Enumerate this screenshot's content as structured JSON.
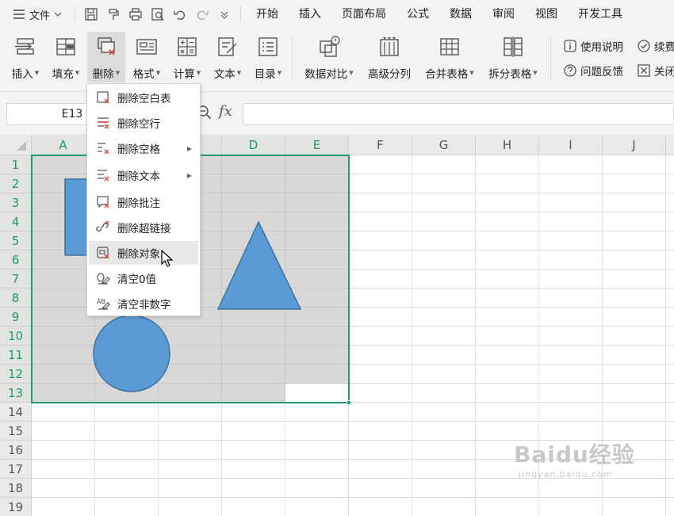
{
  "menubar": {
    "file_label": "文件",
    "tabs": [
      "开始",
      "插入",
      "页面布局",
      "公式",
      "数据",
      "审阅",
      "视图",
      "开发工具"
    ]
  },
  "ribbon": {
    "buttons": [
      "插入",
      "填充",
      "删除",
      "格式",
      "计算",
      "文本",
      "目录",
      "数据对比",
      "高级分列",
      "合并表格",
      "拆分表格"
    ],
    "help_label": "使用说明",
    "feedback_label": "问题反馈",
    "continue_label": "续费",
    "close_label": "关闭"
  },
  "formula_bar": {
    "name_box": "E13",
    "fx_label": "fx",
    "value": ""
  },
  "sheet": {
    "columns": [
      "A",
      "B",
      "C",
      "D",
      "E",
      "F",
      "G",
      "H",
      "I",
      "J"
    ],
    "rows": [
      "1",
      "2",
      "3",
      "4",
      "5",
      "6",
      "7",
      "8",
      "9",
      "10",
      "11",
      "12",
      "13",
      "14",
      "15",
      "16",
      "17",
      "18",
      "19"
    ],
    "selection": "A1:E13",
    "active_cell": "E13"
  },
  "dropdown": {
    "items": [
      "删除空白表",
      "删除空行",
      "删除空格",
      "删除文本",
      "删除批注",
      "删除超链接",
      "删除对象...",
      "清空0值",
      "清空非数字"
    ],
    "hovered": "删除对象..."
  },
  "shapes": {
    "fill_color": "#5b9bd5",
    "stroke_color": "#41719c"
  },
  "watermark": {
    "logo": "Baidu经验",
    "url": "jingyan.baidu.com"
  }
}
